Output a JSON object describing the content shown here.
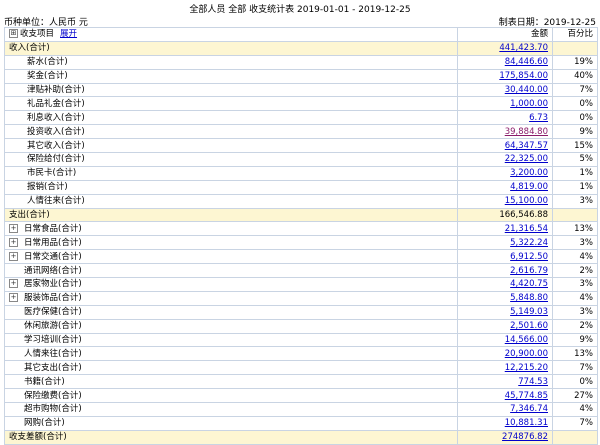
{
  "header": {
    "title": "全部人员 全部 收支统计表 2019-01-01 - 2019-12-25",
    "currency": "币种单位：人民币 元",
    "report_date": "制表日期：2019-12-25"
  },
  "columns": {
    "item": "收支项目",
    "expand": "展开",
    "amount": "金额",
    "percent": "百分比"
  },
  "income": {
    "label": "收入(合计)",
    "amount": "441,423.70",
    "items": [
      {
        "label": "薪水(合计)",
        "amount": "84,446.60",
        "pct": "19%"
      },
      {
        "label": "奖金(合计)",
        "amount": "175,854.00",
        "pct": "40%"
      },
      {
        "label": "津贴补助(合计)",
        "amount": "30,440.00",
        "pct": "7%"
      },
      {
        "label": "礼品礼金(合计)",
        "amount": "1,000.00",
        "pct": "0%"
      },
      {
        "label": "利息收入(合计)",
        "amount": "6.73",
        "pct": "0%"
      },
      {
        "label": "投资收入(合计)",
        "amount": "39,884.80",
        "pct": "9%"
      },
      {
        "label": "其它收入(合计)",
        "amount": "64,347.57",
        "pct": "15%"
      },
      {
        "label": "保险给付(合计)",
        "amount": "22,325.00",
        "pct": "5%"
      },
      {
        "label": "市民卡(合计)",
        "amount": "3,200.00",
        "pct": "1%"
      },
      {
        "label": "报销(合计)",
        "amount": "4,819.00",
        "pct": "1%"
      },
      {
        "label": "人情往来(合计)",
        "amount": "15,100.00",
        "pct": "3%"
      }
    ]
  },
  "expense": {
    "label": "支出(合计)",
    "amount": "166,546.88",
    "items": [
      {
        "label": "日常食品(合计)",
        "amount": "21,316.54",
        "pct": "13%",
        "tog": "+"
      },
      {
        "label": "日常用品(合计)",
        "amount": "5,322.24",
        "pct": "3%",
        "tog": "+"
      },
      {
        "label": "日常交通(合计)",
        "amount": "6,912.50",
        "pct": "4%",
        "tog": "+"
      },
      {
        "label": "通讯网络(合计)",
        "amount": "2,616.79",
        "pct": "2%"
      },
      {
        "label": "居家物业(合计)",
        "amount": "4,420.75",
        "pct": "3%",
        "tog": "+"
      },
      {
        "label": "服装饰品(合计)",
        "amount": "5,848.80",
        "pct": "4%",
        "tog": "+"
      },
      {
        "label": "医疗保健(合计)",
        "amount": "5,149.03",
        "pct": "3%"
      },
      {
        "label": "休闲旅游(合计)",
        "amount": "2,501.60",
        "pct": "2%"
      },
      {
        "label": "学习培训(合计)",
        "amount": "14,566.00",
        "pct": "9%"
      },
      {
        "label": "人情来往(合计)",
        "amount": "20,900.00",
        "pct": "13%"
      },
      {
        "label": "其它支出(合计)",
        "amount": "12,215.20",
        "pct": "7%"
      },
      {
        "label": "书籍(合计)",
        "amount": "774.53",
        "pct": "0%"
      },
      {
        "label": "保险缴费(合计)",
        "amount": "45,774.85",
        "pct": "27%"
      },
      {
        "label": "超市购物(合计)",
        "amount": "7,346.74",
        "pct": "4%"
      },
      {
        "label": "网购(合计)",
        "amount": "10,881.31",
        "pct": "7%"
      }
    ]
  },
  "balance": {
    "label": "收支差额(合计)",
    "amount": "274876.82"
  }
}
